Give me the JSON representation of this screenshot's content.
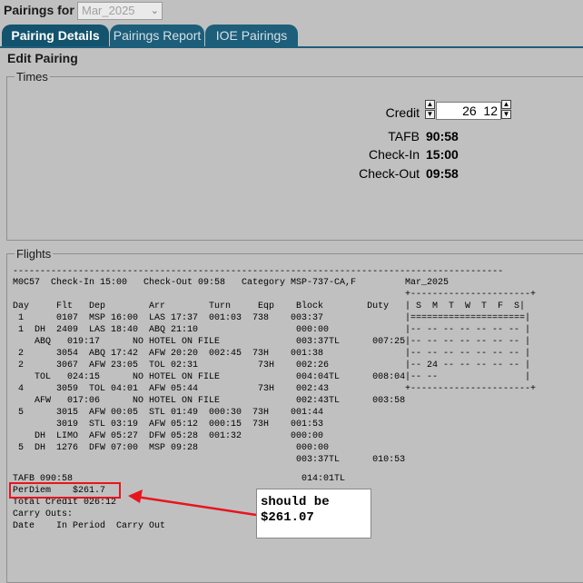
{
  "header": {
    "pairings_label": "Pairings for",
    "month_select": {
      "value": "Mar_2025",
      "arrow_icon": "chevron-down-icon"
    }
  },
  "tabs": [
    {
      "label": "Pairing Details",
      "active": true
    },
    {
      "label": "Pairings Report",
      "active": false
    },
    {
      "label": "IOE Pairings",
      "active": false
    }
  ],
  "edit_title": "Edit Pairing",
  "times": {
    "legend": "Times",
    "credit": {
      "label": "Credit",
      "hours": "26",
      "minutes": "12"
    },
    "tafb": {
      "label": "TAFB",
      "value": "90:58"
    },
    "check_in": {
      "label": "Check-In",
      "value": "15:00"
    },
    "check_out": {
      "label": "Check-Out",
      "value": "09:58"
    }
  },
  "flights": {
    "legend": "Flights",
    "rule_line": "------------------------------------------------------------------------------------------",
    "pairing_header": "M0C57  Check-In 15:00   Check-Out 09:58   Category MSP-737-CA,F",
    "columns": "Day     Flt   Dep        Arr        Turn     Eqp    Block        Duty",
    "rows": [
      " 1      0107  MSP 16:00  LAS 17:37  001:03  738    003:37",
      " 1  DH  2409  LAS 18:40  ABQ 21:10                  000:00",
      "    ABQ   019:17      NO HOTEL ON FILE              003:37TL      007:25",
      " 2      3054  ABQ 17:42  AFW 20:20  002:45  73H    001:38",
      " 2      3067  AFW 23:05  TOL 02:31           73H    002:26",
      "    TOL   024:15      NO HOTEL ON FILE              004:04TL      008:04",
      " 4      3059  TOL 04:01  AFW 05:44           73H    002:43",
      "    AFW   017:06      NO HOTEL ON FILE              002:43TL      003:58",
      " 5      3015  AFW 00:05  STL 01:49  000:30  73H    001:44",
      "        3019  STL 03:19  AFW 05:12  000:15  73H    001:53",
      "    DH  LIMO  AFW 05:27  DFW 05:28  001:32         000:00",
      " 5  DH  1276  DFW 07:00  MSP 09:28                  000:00",
      "                                                    003:37TL      010:53"
    ],
    "summary_lines": [
      "TAFB 090:58                                          014:01TL",
      "PerDiem    $261.7",
      "Total Credit 026:12",
      "Carry Outs:",
      "Date    In Period  Carry Out"
    ],
    "calendar": [
      "Mar_2025",
      "+----------------------+",
      "| S  M  T  W  T  F  S|",
      "|=====================|",
      "|-- -- -- -- -- -- -- |",
      "|-- -- -- -- -- -- -- |",
      "|-- -- -- -- -- -- -- |",
      "|-- 24 -- -- -- -- -- |",
      "|-- --                |",
      "+----------------------+"
    ]
  },
  "annotation": {
    "callout_text": "should be\n$261.07",
    "accent_color": "#e8141e"
  }
}
